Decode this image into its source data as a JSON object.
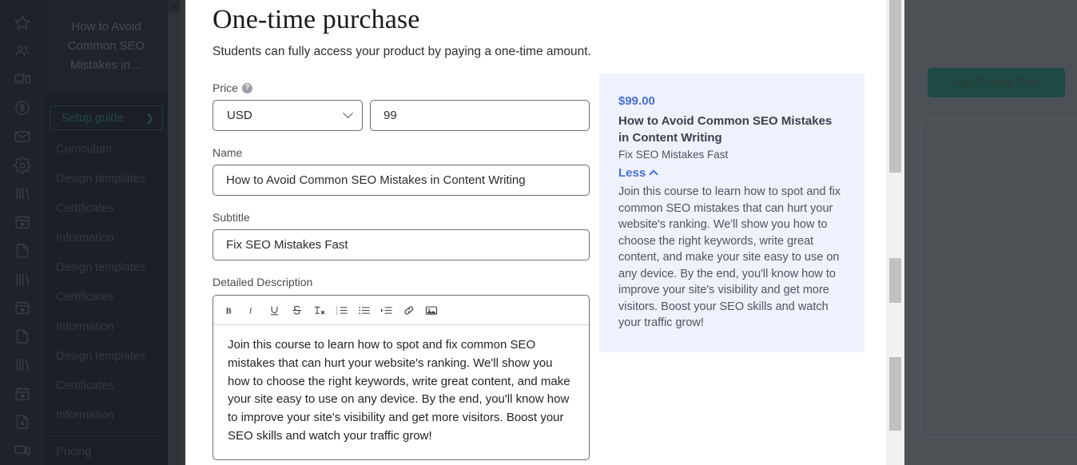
{
  "background": {
    "add_pricing_plan_button": "Add Pricing Plan"
  },
  "icon_rail": {
    "icons": [
      "star-icon",
      "people-icon",
      "devices-icon",
      "dollar-circle-icon",
      "envelope-icon",
      "gear-icon",
      "books-icon",
      "calendar-icon",
      "page-icon",
      "books-icon-2",
      "calendar-icon-2",
      "page-icon-2",
      "books-icon-3",
      "calendar-icon-3",
      "page-download-icon",
      "monitor-icon"
    ]
  },
  "sidebar": {
    "course_title": "How to Avoid Common SEO Mistakes in…",
    "setup_guide": {
      "label": "Setup guide",
      "chevron": "chevron-right-icon"
    },
    "items": [
      "Curriculum",
      "Design templates",
      "Certificates",
      "Information",
      "Design templates",
      "Certificates",
      "Information",
      "Design templates",
      "Certificates",
      "Information"
    ],
    "bottom_item": "Pricing"
  },
  "modal": {
    "title": "One-time purchase",
    "subtitle": "Students can fully access your product by paying a one-time amount.",
    "fields": {
      "price": {
        "label": "Price",
        "help_icon": "help-circle-icon",
        "currency_value": "USD",
        "currency_chevron": "chevron-down-icon",
        "amount_value": "99",
        "amount_placeholder": "0"
      },
      "name": {
        "label": "Name",
        "value": "How to Avoid Common SEO Mistakes in Content Writing",
        "placeholder": "Name"
      },
      "subtitle": {
        "label": "Subtitle",
        "value": "Fix SEO Mistakes Fast",
        "placeholder": "Subtitle"
      },
      "detailed_description": {
        "label": "Detailed Description",
        "value": "Join this course to learn how to spot and fix common SEO mistakes that can hurt your website's ranking. We'll show you how to choose the right keywords, write great content, and make your site easy to use on any device. By the end, you'll know how to improve your site's visibility and get more visitors. Boost your SEO skills and watch your traffic grow!"
      }
    },
    "toolbar": {
      "buttons": [
        {
          "name": "bold-icon",
          "label": "B"
        },
        {
          "name": "italic-icon",
          "label": "I"
        },
        {
          "name": "underline-icon",
          "label": "U"
        },
        {
          "name": "strikethrough-icon",
          "label": "S"
        },
        {
          "name": "clear-format-icon",
          "label": "Tx"
        },
        {
          "name": "ordered-list-icon",
          "label": "1."
        },
        {
          "name": "unordered-list-icon",
          "label": "•"
        },
        {
          "name": "indent-icon",
          "label": "⇥"
        },
        {
          "name": "link-icon",
          "label": "🔗"
        },
        {
          "name": "image-icon",
          "label": "🖼"
        }
      ]
    },
    "preview": {
      "price": "$99.00",
      "name": "How to Avoid Common SEO Mistakes in Content Writing",
      "subtitle": "Fix SEO Mistakes Fast",
      "toggle_label": "Less",
      "toggle_icon": "chevron-up-icon",
      "description": "Join this course to learn how to spot and fix common SEO mistakes that can hurt your website's ranking. We'll show you how to choose the right keywords, write great content, and make your site easy to use on any device. By the end, you'll know how to improve your site's visibility and get more visitors. Boost your SEO skills and watch your traffic grow!"
    }
  },
  "colors": {
    "accent_blue": "#4a6fd4",
    "preview_bg": "#eef2fc",
    "brand_green": "#1d4a42",
    "sidebar_dark": "#22272e",
    "rail_dark": "#262c33"
  }
}
